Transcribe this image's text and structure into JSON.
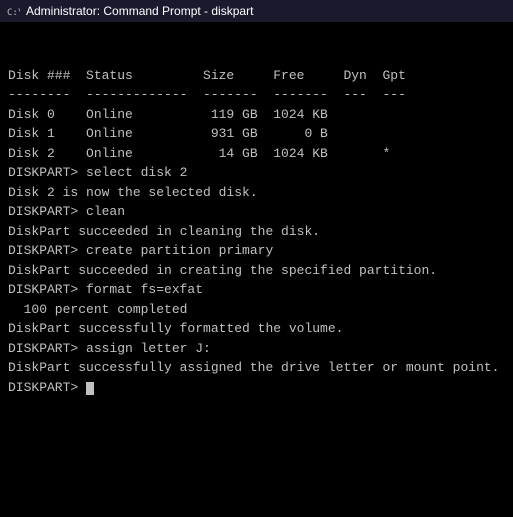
{
  "titleBar": {
    "icon": "cmd-icon",
    "title": "Administrator: Command Prompt - diskpart"
  },
  "terminal": {
    "lines": [
      "",
      "Disk ###  Status         Size     Free     Dyn  Gpt",
      "--------  -------------  -------  -------  ---  ---",
      "Disk 0    Online          119 GB  1024 KB",
      "Disk 1    Online          931 GB      0 B",
      "Disk 2    Online           14 GB  1024 KB       *",
      "",
      "DISKPART> select disk 2",
      "",
      "Disk 2 is now the selected disk.",
      "",
      "DISKPART> clean",
      "",
      "DiskPart succeeded in cleaning the disk.",
      "",
      "DISKPART> create partition primary",
      "",
      "DiskPart succeeded in creating the specified partition.",
      "",
      "DISKPART> format fs=exfat",
      "",
      "  100 percent completed",
      "",
      "DiskPart successfully formatted the volume.",
      "",
      "DISKPART> assign letter J:",
      "",
      "DiskPart successfully assigned the drive letter or mount point.",
      "",
      "DISKPART> _"
    ]
  }
}
